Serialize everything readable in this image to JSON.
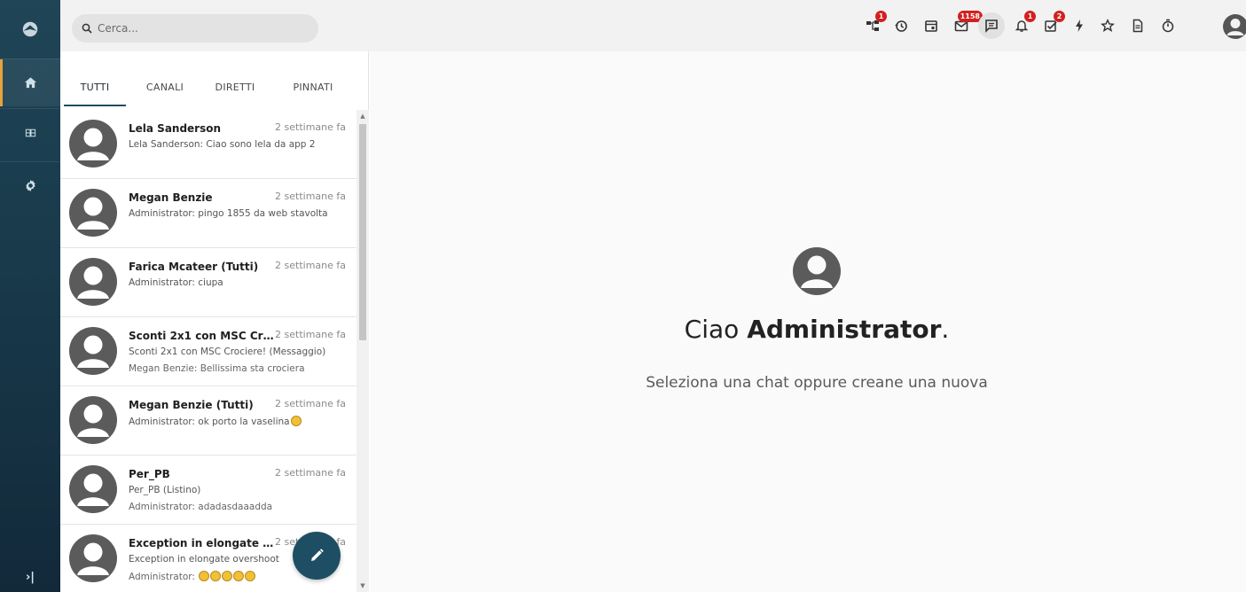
{
  "search": {
    "placeholder": "Cerca..."
  },
  "toolbar": {
    "icons": [
      {
        "name": "workflow-icon",
        "badge": "1"
      },
      {
        "name": "history-icon",
        "badge": ""
      },
      {
        "name": "calendar-icon",
        "badge": ""
      },
      {
        "name": "mail-icon",
        "badge": "1158"
      },
      {
        "name": "chat-icon",
        "badge": ""
      },
      {
        "name": "bell-icon",
        "badge": "1"
      },
      {
        "name": "tasks-icon",
        "badge": "2"
      },
      {
        "name": "flash-icon",
        "badge": ""
      },
      {
        "name": "star-icon",
        "badge": ""
      },
      {
        "name": "document-icon",
        "badge": ""
      },
      {
        "name": "timer-icon",
        "badge": ""
      }
    ]
  },
  "sidebar": {
    "items": [
      {
        "name": "home-icon"
      },
      {
        "name": "grid-icon"
      },
      {
        "name": "settings-icon"
      }
    ],
    "collapse_label": "›|"
  },
  "tabs": [
    "TUTTI",
    "CANALI",
    "DIRETTI",
    "PINNATI"
  ],
  "chats": [
    {
      "name": "Lela Sanderson",
      "time": "2 settimane fa",
      "line1": "Lela Sanderson: Ciao sono lela da app 2",
      "line2": ""
    },
    {
      "name": "Megan Benzie",
      "time": "2 settimane fa",
      "line1": "Administrator: pingo 1855 da web stavolta",
      "line2": ""
    },
    {
      "name": "Farica Mcateer (Tutti)",
      "time": "2 settimane fa",
      "line1": "Administrator: ciupa",
      "line2": ""
    },
    {
      "name": "Sconti 2x1 con MSC Croc...",
      "time": "2 settimane fa",
      "line1": "Sconti 2x1 con MSC Crociere! (Messaggio)",
      "line2": "Megan Benzie: Bellissima sta crociera"
    },
    {
      "name": "Megan Benzie (Tutti)",
      "time": "2 settimane fa",
      "line1": "Administrator: ok porto la vaselina",
      "line2": ""
    },
    {
      "name": "Per_PB",
      "time": "2 settimane fa",
      "line1": "Per_PB (Listino)",
      "line2": "Administrator: adadasdaaadda"
    },
    {
      "name": "Exception in elongate o...",
      "time": "2 settimane fa",
      "line1": "Exception in elongate overshoot",
      "line2": "Administrator: "
    }
  ],
  "welcome": {
    "greeting_prefix": "Ciao ",
    "greeting_name": "Administrator",
    "greeting_suffix": ".",
    "subtitle": "Seleziona una chat oppure creane una nuova"
  },
  "colors": {
    "rail": "#1f4556",
    "accent": "#1d4e64",
    "badge": "#d32020",
    "active_marker": "#e8a33a"
  }
}
